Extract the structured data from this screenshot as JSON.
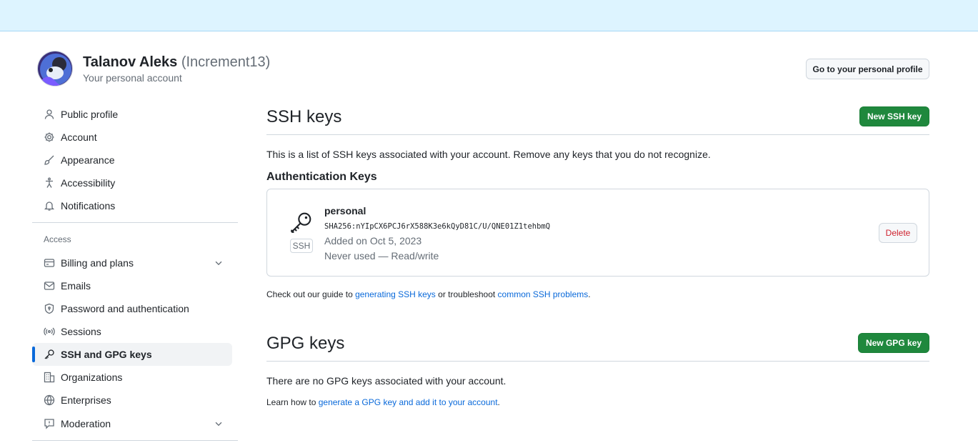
{
  "account": {
    "name": "Talanov Aleks",
    "login": "(Increment13)",
    "subtitle": "Your personal account",
    "go_profile_label": "Go to your personal profile"
  },
  "sidebar": {
    "items": [
      {
        "label": "Public profile",
        "icon": "person-icon"
      },
      {
        "label": "Account",
        "icon": "gear-icon"
      },
      {
        "label": "Appearance",
        "icon": "paintbrush-icon"
      },
      {
        "label": "Accessibility",
        "icon": "accessibility-icon"
      },
      {
        "label": "Notifications",
        "icon": "bell-icon"
      }
    ],
    "access_heading": "Access",
    "access_items": [
      {
        "label": "Billing and plans",
        "icon": "credit-card-icon"
      },
      {
        "label": "Emails",
        "icon": "mail-icon"
      },
      {
        "label": "Password and authentication",
        "icon": "shield-lock-icon"
      },
      {
        "label": "Sessions",
        "icon": "broadcast-icon"
      },
      {
        "label": "SSH and GPG keys",
        "icon": "key-icon"
      },
      {
        "label": "Organizations",
        "icon": "organization-icon"
      },
      {
        "label": "Enterprises",
        "icon": "globe-icon"
      },
      {
        "label": "Moderation",
        "icon": "report-icon"
      }
    ]
  },
  "ssh": {
    "title": "SSH keys",
    "new_button": "New SSH key",
    "description": "This is a list of SSH keys associated with your account. Remove any keys that you do not recognize.",
    "auth_heading": "Authentication Keys",
    "key": {
      "badge": "SSH",
      "title": "personal",
      "fingerprint": "SHA256:nYIpCX6PCJ6rX588K3e6kQyD81C/U/QNE01Z1tehbmQ",
      "added": "Added on Oct 5, 2023",
      "usage": "Never used — Read/write",
      "delete_label": "Delete"
    },
    "guide_prefix": "Check out our guide to ",
    "guide_link1": "generating SSH keys",
    "guide_mid": " or troubleshoot ",
    "guide_link2": "common SSH problems",
    "guide_suffix": "."
  },
  "gpg": {
    "title": "GPG keys",
    "new_button": "New GPG key",
    "empty_text": "There are no GPG keys associated with your account.",
    "learn_prefix": "Learn how to ",
    "learn_link": "generate a GPG key and add it to your account",
    "learn_suffix": "."
  },
  "colors": {
    "accent": "#0969da",
    "primary_button": "#1f883d",
    "danger": "#cf222e",
    "banner": "#ddf4ff"
  }
}
